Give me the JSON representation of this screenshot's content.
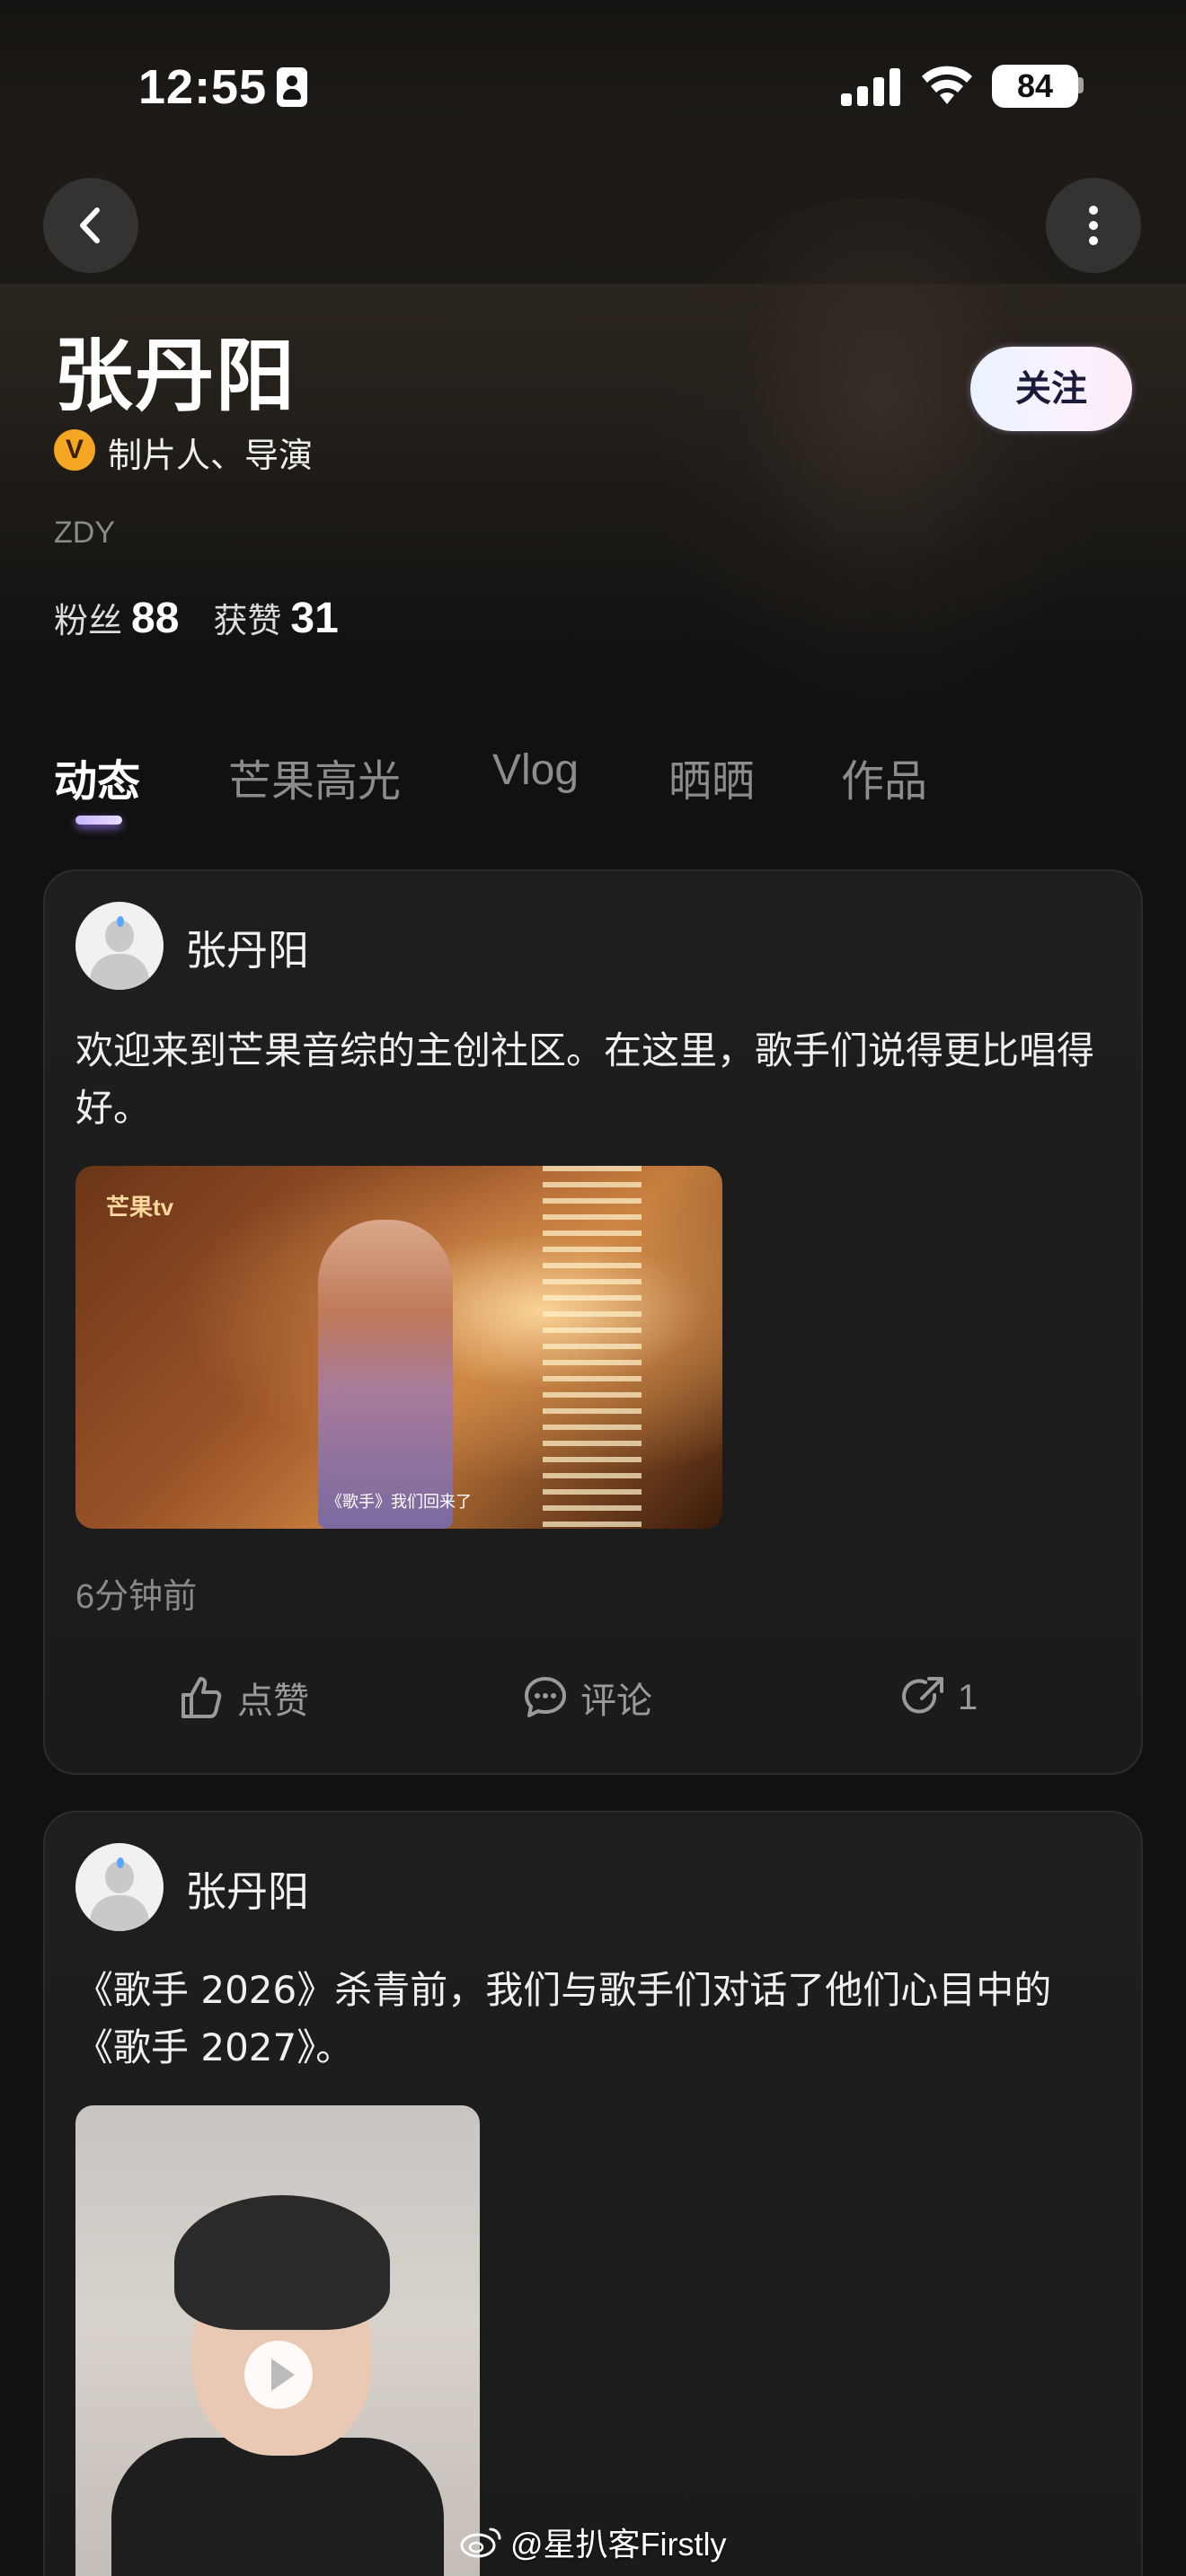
{
  "status_bar": {
    "time": "12:55",
    "battery": "84"
  },
  "profile": {
    "name": "张丹阳",
    "verified_badge": "V",
    "role": "制片人、导演",
    "handle": "ZDY",
    "fans_label": "粉丝",
    "fans_count": "88",
    "likes_label": "获赞",
    "likes_count": "31",
    "follow_label": "关注"
  },
  "tabs": [
    {
      "label": "动态",
      "active": true
    },
    {
      "label": "芒果高光",
      "active": false
    },
    {
      "label": "Vlog",
      "active": false
    },
    {
      "label": "晒晒",
      "active": false
    },
    {
      "label": "作品",
      "active": false
    }
  ],
  "posts": [
    {
      "author": "张丹阳",
      "text": "欢迎来到芒果音综的主创社区。在这里，歌手们说得更比唱得好。",
      "media_logo": "芒果tv",
      "media_caption": "《歌手》我们回来了",
      "time": "6分钟前",
      "actions": {
        "like": "点赞",
        "comment": "评论",
        "share_count": "1"
      }
    },
    {
      "author": "张丹阳",
      "text": "《歌手 2026》杀青前，我们与歌手们对话了他们心目中的《歌手 2027》。"
    }
  ],
  "watermark": "@星扒客Firstly",
  "icons": {
    "back": "chevron-left-icon",
    "more": "more-vertical-icon",
    "like": "thumbs-up-icon",
    "comment": "comment-bubble-icon",
    "share": "share-icon",
    "play": "play-icon"
  },
  "colors": {
    "background": "#111111",
    "badge": "#f5a623",
    "tab_indicator": "#c9b5ff",
    "muted_text": "#8a8a8a"
  }
}
